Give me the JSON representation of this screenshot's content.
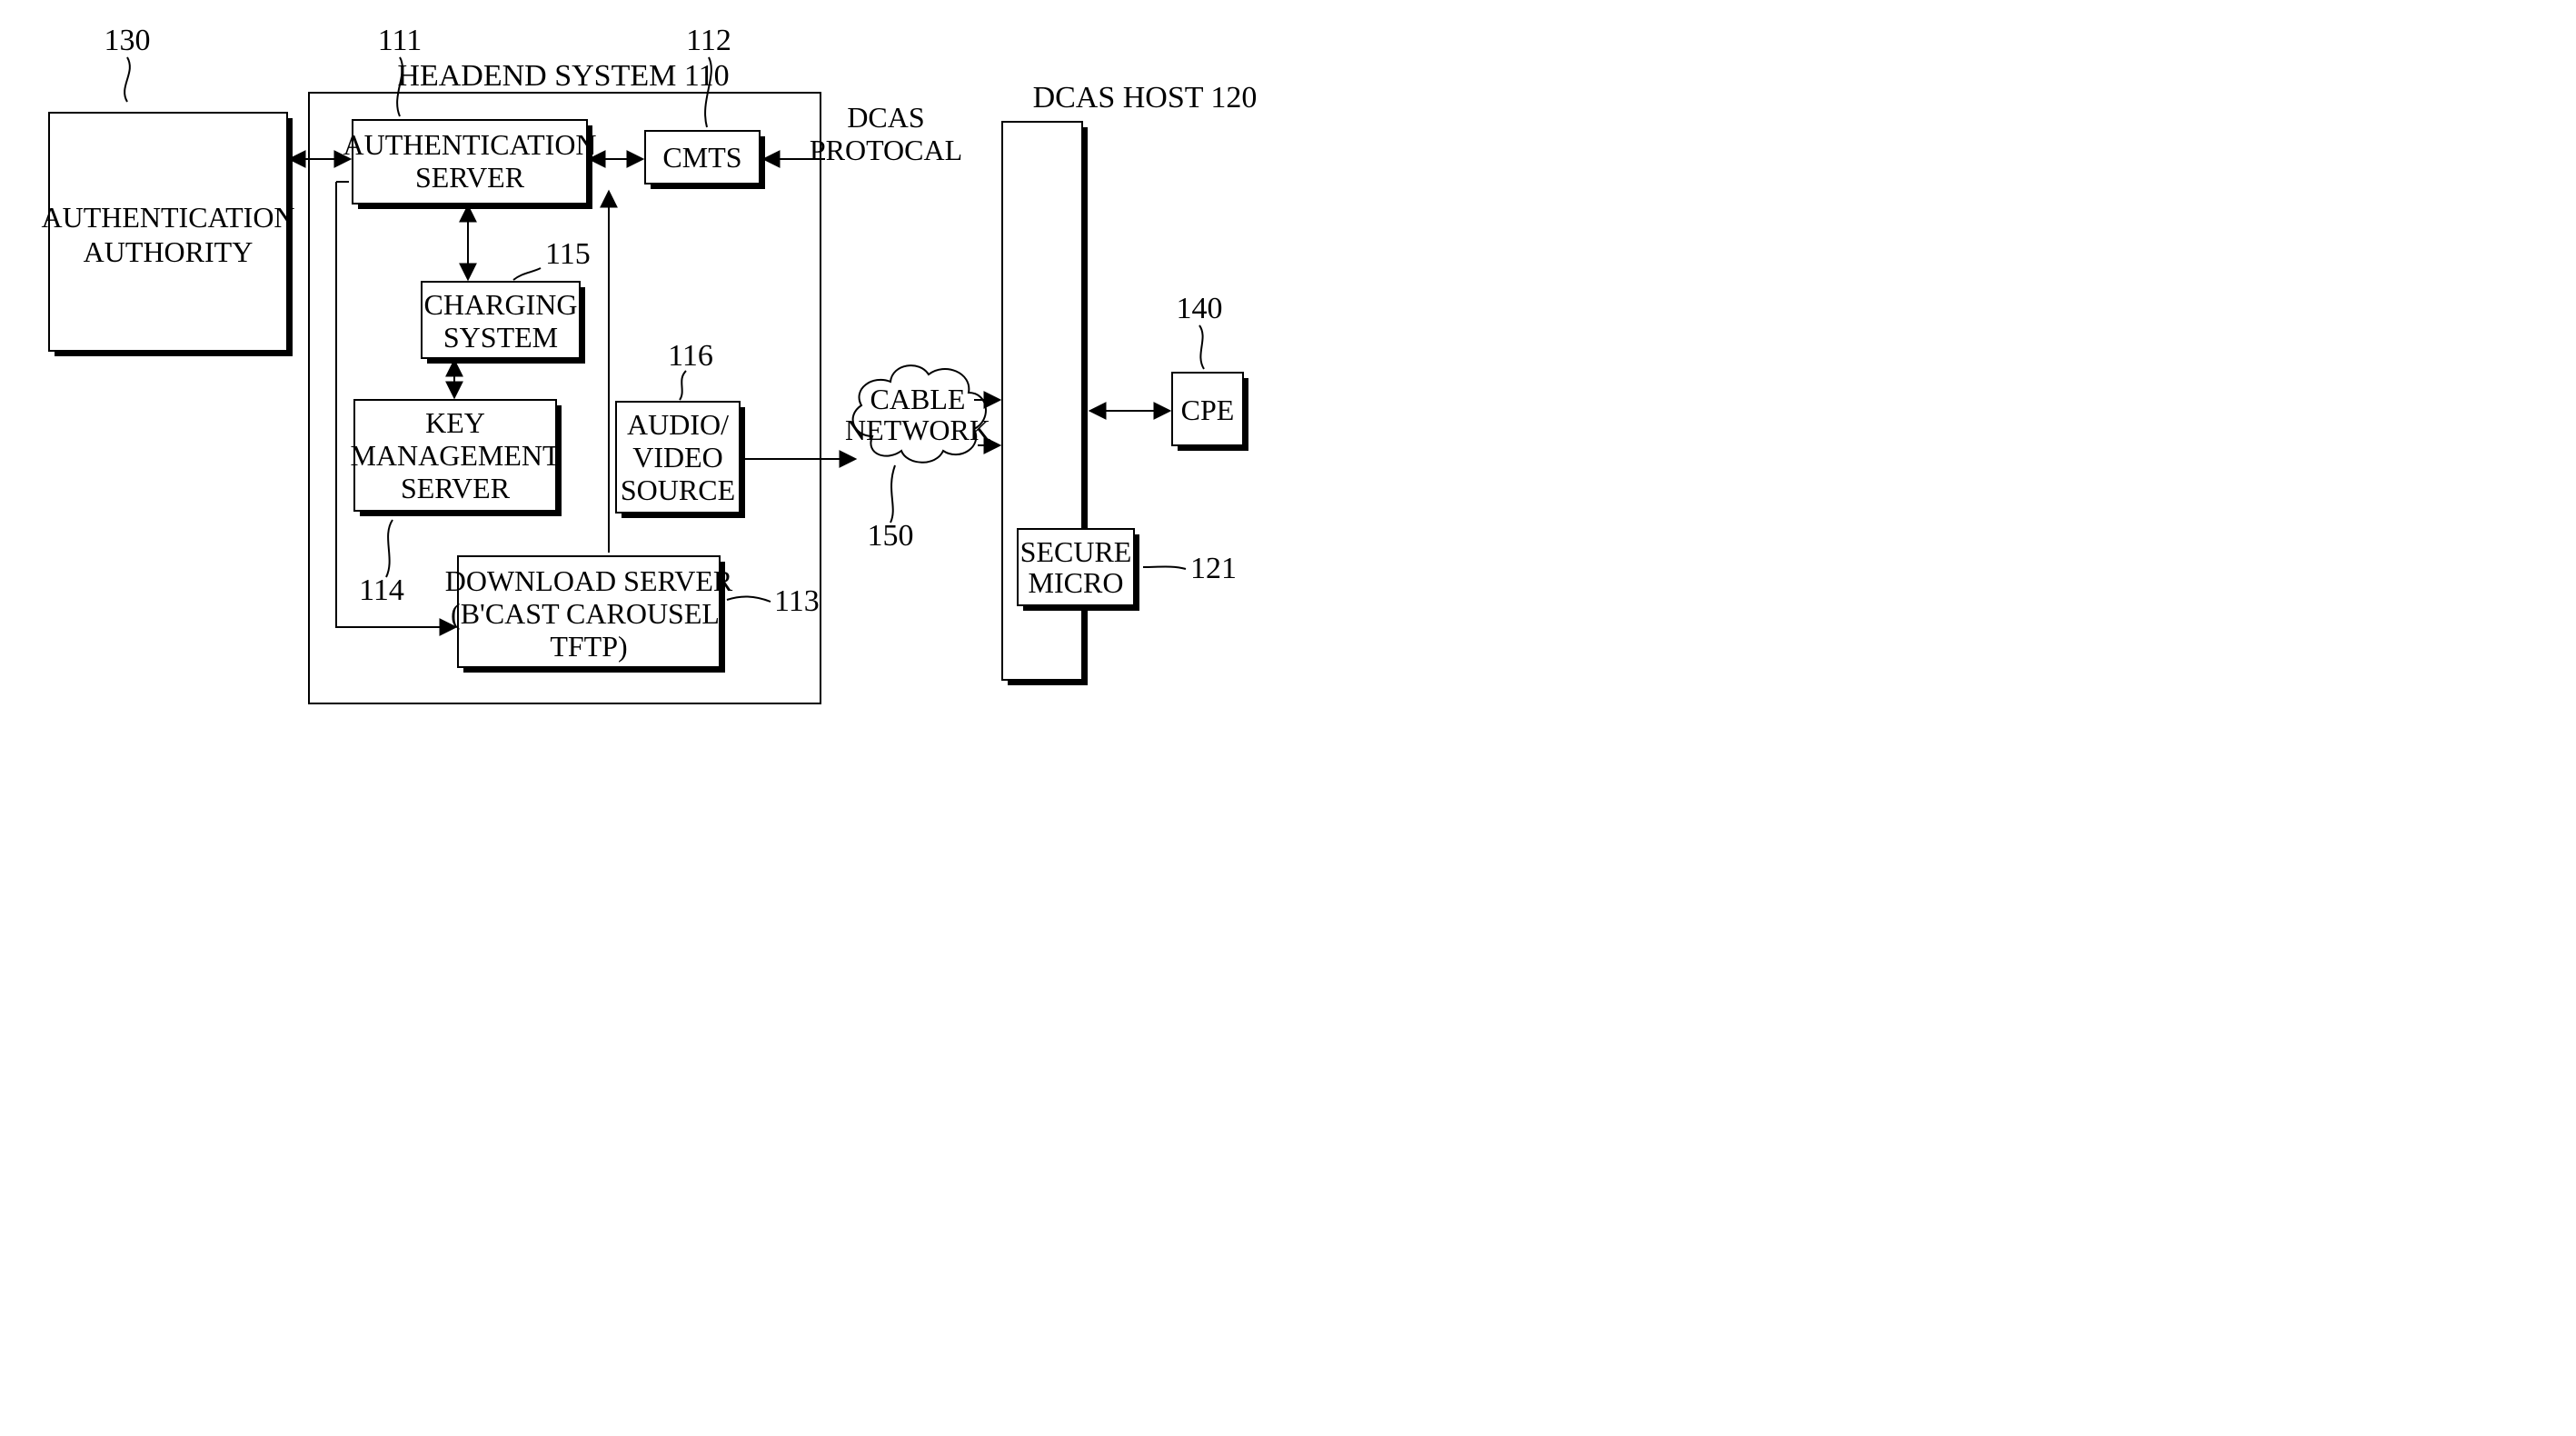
{
  "refs": {
    "r130": "130",
    "r111": "111",
    "r112": "112",
    "r115": "115",
    "r116": "116",
    "r114": "114",
    "r113": "113",
    "r150": "150",
    "r120_title": "DCAS HOST 120",
    "r110_title": "HEADEND SYSTEM 110",
    "r140": "140",
    "r121": "121"
  },
  "boxes": {
    "auth_authority_l1": "AUTHENTICATION",
    "auth_authority_l2": "AUTHORITY",
    "auth_server_l1": "AUTHENTICATION",
    "auth_server_l2": "SERVER",
    "cmts": "CMTS",
    "charging_l1": "CHARGING",
    "charging_l2": "SYSTEM",
    "key_mgmt_l1": "KEY",
    "key_mgmt_l2": "MANAGEMENT",
    "key_mgmt_l3": "SERVER",
    "av_l1": "AUDIO/",
    "av_l2": "VIDEO",
    "av_l3": "SOURCE",
    "download_l1": "DOWNLOAD SERVER",
    "download_l2": "(B'CAST CAROUSEL,",
    "download_l3": "TFTP)",
    "cable_net_l1": "CABLE",
    "cable_net_l2": "NETWORK",
    "secure_micro_l1": "SECURE",
    "secure_micro_l2": "MICRO",
    "cpe": "CPE"
  },
  "labels": {
    "dcas_proto_l1": "DCAS",
    "dcas_proto_l2": "PROTOCAL"
  }
}
